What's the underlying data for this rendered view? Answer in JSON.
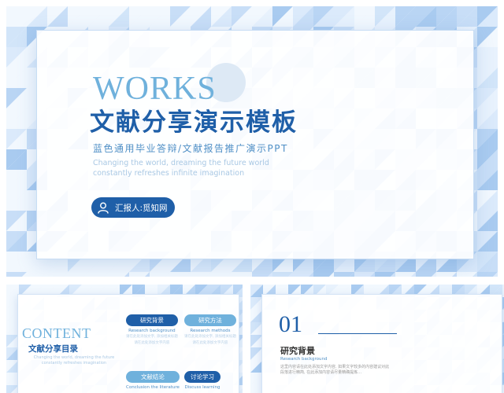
{
  "cover": {
    "works": "WORKS",
    "title": "文献分享演示模板",
    "subtitle": "蓝色通用毕业答辩/文献报告推广演示PPT",
    "tagline_line1": "Changing the world, dreaming the future world",
    "tagline_line2": "constantly refreshes infinite imagination",
    "reporter": "汇报人:觅知网",
    "reporter_icon": "user-icon"
  },
  "contents_slide": {
    "title": "CONTENT",
    "subtitle": "文献分享目录",
    "tagline": "Changing the world, dreaming the future constantly refreshes imagination",
    "items": [
      {
        "label": "研究背景",
        "en": "Research background",
        "desc1": "请在此处添加文字, 添加相关标题",
        "desc2": "请在此处添加文字内容"
      },
      {
        "label": "研究方法",
        "en": "Research methods",
        "desc1": "请在此处添加文字, 添加相关标题",
        "desc2": "请在此处添加文字内容"
      },
      {
        "label": "文献结论",
        "en": "Conclusion the literature",
        "desc1": "",
        "desc2": ""
      },
      {
        "label": "讨论学习",
        "en": "Discuss learning",
        "desc1": "",
        "desc2": ""
      }
    ]
  },
  "section_slide": {
    "number": "01",
    "title": "研究背景",
    "en": "Research background",
    "desc": "这里内容请在此处添加文字内容, 如果文字较多的内容建议对此段落进行精简, 在此添加内容请尽量精确提炼…"
  },
  "colors": {
    "primary": "#1f5fa8",
    "accent": "#6fb1dc",
    "pale": "#a9c8e4",
    "background": "#eef5fd"
  }
}
